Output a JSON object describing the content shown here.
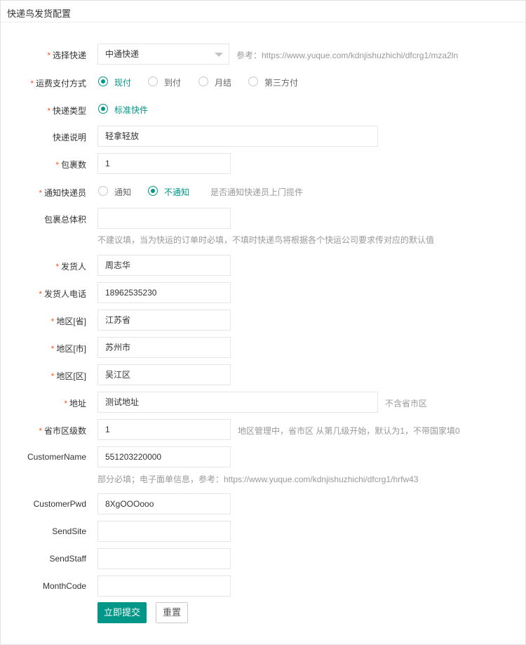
{
  "title": "快递鸟发货配置",
  "required_mark": "*",
  "courier": {
    "label": "选择快递",
    "value": "中通快递",
    "aux": "参考：https://www.yuque.com/kdnjishuzhichi/dfcrg1/mza2ln"
  },
  "payment": {
    "label": "运费支付方式",
    "options": [
      "现付",
      "到付",
      "月结",
      "第三方付"
    ],
    "selected": "现付"
  },
  "express_type": {
    "label": "快递类型",
    "options": [
      "标准快件"
    ],
    "selected": "标准快件"
  },
  "remark": {
    "label": "快递说明",
    "value": "轻拿轻放"
  },
  "packages": {
    "label": "包裹数",
    "value": "1"
  },
  "notify": {
    "label": "通知快递员",
    "options": [
      "通知",
      "不通知"
    ],
    "selected": "不通知",
    "aux": "是否通知快递员上门揽件"
  },
  "volume": {
    "label": "包裹总体积",
    "value": "",
    "hint": "不建议填，当为快运的订单时必填，不填时快递鸟将根据各个快运公司要求传对应的默认值"
  },
  "sender": {
    "label": "发货人",
    "value": "周志华"
  },
  "sender_phone": {
    "label": "发货人电话",
    "value": "18962535230"
  },
  "province": {
    "label": "地区[省]",
    "value": "江苏省"
  },
  "city": {
    "label": "地区[市]",
    "value": "苏州市"
  },
  "district": {
    "label": "地区[区]",
    "value": "吴江区"
  },
  "address": {
    "label": "地址",
    "value": "测试地址",
    "aux": "不含省市区"
  },
  "region_level": {
    "label": "省市区级数",
    "value": "1",
    "aux": "地区管理中，省市区 从第几级开始，默认为1，不带国家填0"
  },
  "customer_name": {
    "label": "CustomerName",
    "value": "551203220000",
    "hint": "部分必填；电子面单信息，参考：https://www.yuque.com/kdnjishuzhichi/dfcrg1/hrfw43"
  },
  "customer_pwd": {
    "label": "CustomerPwd",
    "value": "8XgOOOooo"
  },
  "send_site": {
    "label": "SendSite",
    "value": ""
  },
  "send_staff": {
    "label": "SendStaff",
    "value": ""
  },
  "month_code": {
    "label": "MonthCode",
    "value": ""
  },
  "buttons": {
    "submit": "立即提交",
    "reset": "重置"
  },
  "colors": {
    "accent": "#009688",
    "required": "#ff5722",
    "hint": "#999999"
  }
}
